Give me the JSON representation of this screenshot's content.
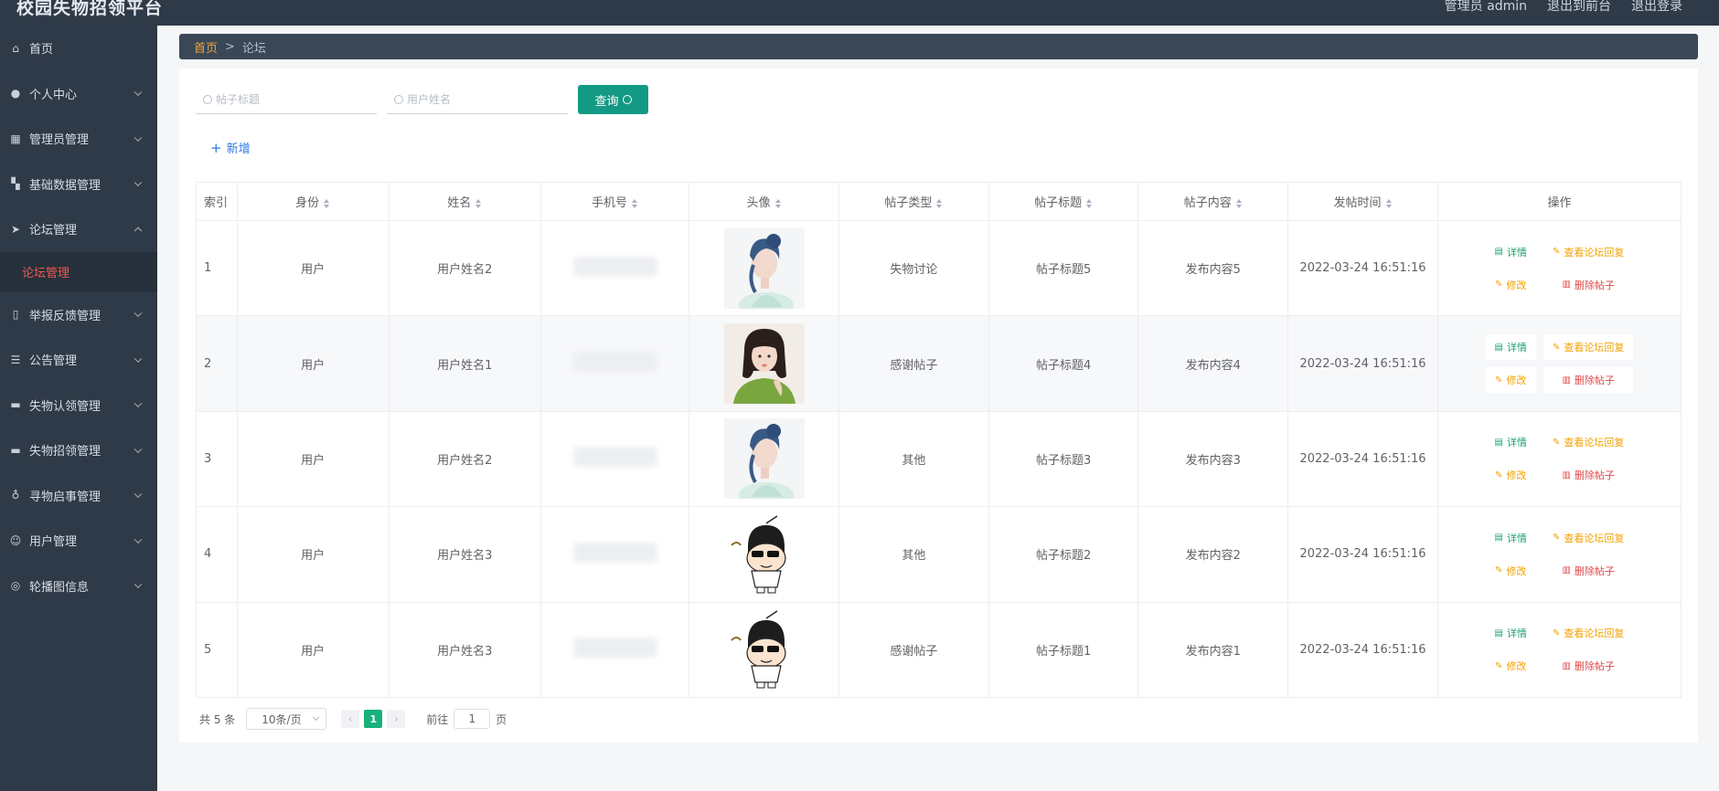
{
  "app": {
    "title": "校园失物招领平台"
  },
  "topbar": {
    "user": "管理员 admin",
    "frontend": "退出到前台",
    "logout": "退出登录"
  },
  "sidebar": {
    "items": [
      {
        "label": "首页",
        "icon": "home-icon",
        "glyph": "⌂",
        "expandable": false
      },
      {
        "label": "个人中心",
        "icon": "user-icon",
        "glyph": "●",
        "expandable": true
      },
      {
        "label": "管理员管理",
        "icon": "grid-icon",
        "glyph": "▦",
        "expandable": true
      },
      {
        "label": "基础数据管理",
        "icon": "apps-icon",
        "glyph": "▚",
        "expandable": true
      },
      {
        "label": "论坛管理",
        "icon": "send-icon",
        "glyph": "➤",
        "expandable": true,
        "open": true
      },
      {
        "label": "举报反馈管理",
        "icon": "phone-icon",
        "glyph": "▯",
        "expandable": true
      },
      {
        "label": "公告管理",
        "icon": "filter-icon",
        "glyph": "☰",
        "expandable": true
      },
      {
        "label": "失物认领管理",
        "icon": "monitor-icon",
        "glyph": "▬",
        "expandable": true
      },
      {
        "label": "失物招领管理",
        "icon": "chat-icon",
        "glyph": "▬",
        "expandable": true
      },
      {
        "label": "寻物启事管理",
        "icon": "mic-icon",
        "glyph": "♁",
        "expandable": true
      },
      {
        "label": "用户管理",
        "icon": "smile-icon",
        "glyph": "☺",
        "expandable": true
      },
      {
        "label": "轮播图信息",
        "icon": "compass-icon",
        "glyph": "◎",
        "expandable": true
      }
    ],
    "submenu_label": "论坛管理"
  },
  "breadcrumb": {
    "home": "首页",
    "separator": ">",
    "current": "论坛"
  },
  "search": {
    "title_placeholder": "帖子标题",
    "user_placeholder": "用户姓名",
    "query_label": "查询"
  },
  "add_label": "新增",
  "table": {
    "headers": {
      "index": "索引",
      "role": "身份",
      "name": "姓名",
      "phone": "手机号",
      "avatar": "头像",
      "type": "帖子类型",
      "title": "帖子标题",
      "content": "帖子内容",
      "time": "发帖时间",
      "ops": "操作"
    },
    "rows": [
      {
        "index": "1",
        "role": "用户",
        "name": "用户姓名2",
        "avatar": "woman-blue-hair",
        "type": "失物讨论",
        "title": "帖子标题5",
        "content": "发布内容5",
        "time": "2022-03-24 16:51:16"
      },
      {
        "index": "2",
        "role": "用户",
        "name": "用户姓名1",
        "avatar": "woman-green-sweater",
        "type": "感谢帖子",
        "title": "帖子标题4",
        "content": "发布内容4",
        "time": "2022-03-24 16:51:16"
      },
      {
        "index": "3",
        "role": "用户",
        "name": "用户姓名2",
        "avatar": "woman-blue-hair",
        "type": "其他",
        "title": "帖子标题3",
        "content": "发布内容3",
        "time": "2022-03-24 16:51:16"
      },
      {
        "index": "4",
        "role": "用户",
        "name": "用户姓名3",
        "avatar": "cartoon-boy",
        "type": "其他",
        "title": "帖子标题2",
        "content": "发布内容2",
        "time": "2022-03-24 16:51:16"
      },
      {
        "index": "5",
        "role": "用户",
        "name": "用户姓名3",
        "avatar": "cartoon-boy",
        "type": "感谢帖子",
        "title": "帖子标题1",
        "content": "发布内容1",
        "time": "2022-03-24 16:51:16"
      }
    ],
    "ops": {
      "detail": "详情",
      "reply": "查看论坛回复",
      "edit": "修改",
      "delete": "删除帖子"
    }
  },
  "pagination": {
    "total": "共 5 条",
    "page_size": "10条/页",
    "current_page": "1",
    "goto_prefix": "前往",
    "goto_value": "1",
    "goto_suffix": "页"
  },
  "colors": {
    "sidebar_bg": "#2f3a48",
    "accent": "#149a84",
    "active_menu": "#e85a4f",
    "breadcrumb_home": "#f0a23b"
  }
}
